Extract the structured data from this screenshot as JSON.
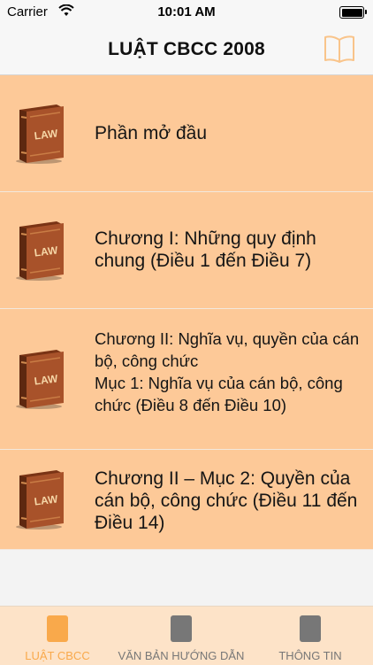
{
  "status": {
    "carrier": "Carrier",
    "time": "10:01 AM"
  },
  "nav": {
    "title": "LUẬT CBCC 2008"
  },
  "book_label": "LAW",
  "list": [
    {
      "title": "Phần mở đầu"
    },
    {
      "title": "Chương I: Những quy định chung (Điều 1 đến Điều 7)"
    },
    {
      "title": "Chương II: Nghĩa vụ, quyền của cán bộ, công chức\n Mục 1: Nghĩa vụ của cán bộ, công chức (Điều 8 đến Điều 10)"
    },
    {
      "title": "Chương II – Mục 2: Quyền của cán bộ, công chức (Điều 11 đến Điều 14)"
    }
  ],
  "tabs": [
    {
      "label": "LUẬT CBCC",
      "active": true
    },
    {
      "label": "VĂN BẢN HƯỚNG DẪN",
      "active": false
    },
    {
      "label": "THÔNG TIN",
      "active": false
    }
  ],
  "colors": {
    "accent": "#f9a94b",
    "row": "#fdc998",
    "tab_inactive": "#777777"
  }
}
